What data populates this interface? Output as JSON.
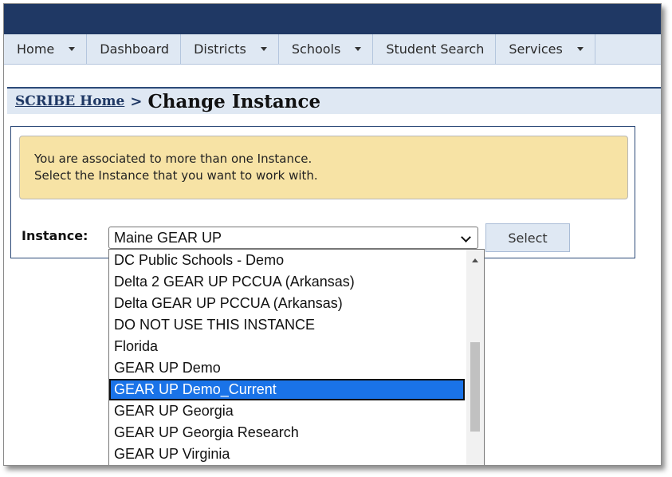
{
  "nav": {
    "items": [
      {
        "label": "Home",
        "has_menu": true
      },
      {
        "label": "Dashboard",
        "has_menu": false
      },
      {
        "label": "Districts",
        "has_menu": true
      },
      {
        "label": "Schools",
        "has_menu": true
      },
      {
        "label": "Student Search",
        "has_menu": false
      },
      {
        "label": "Services",
        "has_menu": true
      }
    ]
  },
  "breadcrumb": {
    "home_link": "SCRIBE Home",
    "separator": ">",
    "title": "Change Instance"
  },
  "notice": {
    "line1": "You are associated to more than one Instance.",
    "line2": "Select the Instance that you want to work with."
  },
  "form": {
    "instance_label": "Instance:",
    "selected_value": "Maine GEAR UP",
    "select_button_label": "Select"
  },
  "dropdown": {
    "options": [
      "DC Public Schools - Demo",
      "Delta 2 GEAR UP PCCUA (Arkansas)",
      "Delta GEAR UP PCCUA (Arkansas)",
      "DO NOT USE THIS INSTANCE",
      "Florida",
      "GEAR UP Demo",
      "GEAR UP Demo_Current",
      "GEAR UP Georgia",
      "GEAR UP Georgia Research",
      "GEAR UP Virginia"
    ],
    "highlighted_index": 6
  },
  "colors": {
    "header_navy": "#1f3864",
    "nav_bg": "#dfe8f3",
    "notice_bg": "#f7e3a5",
    "highlight": "#1a73e8"
  }
}
